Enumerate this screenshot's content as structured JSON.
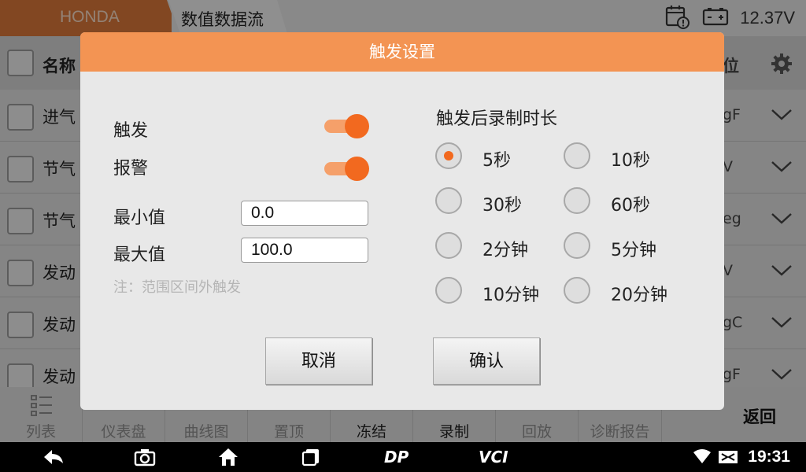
{
  "topbar": {
    "brand": "HONDA",
    "breadcrumb": "数值数据流",
    "voltage": "12.37V"
  },
  "table": {
    "header_name": "名称",
    "header_unit": "位",
    "rows": [
      {
        "name": "进气",
        "unit": "gF"
      },
      {
        "name": "节气",
        "unit": "V"
      },
      {
        "name": "节气",
        "unit": "eg"
      },
      {
        "name": "发动",
        "unit": "V"
      },
      {
        "name": "发动",
        "unit": "gC"
      },
      {
        "name": "发动",
        "unit": "gF"
      }
    ]
  },
  "toolbar": {
    "items": [
      "列表",
      "仪表盘",
      "曲线图",
      "置顶",
      "冻结",
      "录制",
      "回放",
      "诊断报告"
    ],
    "back": "返回"
  },
  "statusbar": {
    "time": "19:31",
    "dp_label": "DP",
    "vci_label": "VCI"
  },
  "dialog": {
    "title": "触发设置",
    "trigger_label": "触发",
    "trigger_on": true,
    "alarm_label": "报警",
    "alarm_on": true,
    "min_label": "最小值",
    "min_value": "0.0",
    "max_label": "最大值",
    "max_value": "100.0",
    "note": "注：范围区间外触发",
    "duration_title": "触发后录制时长",
    "options": [
      "5秒",
      "10秒",
      "30秒",
      "60秒",
      "2分钟",
      "5分钟",
      "10分钟",
      "20分钟"
    ],
    "selected_option": "5秒",
    "cancel": "取消",
    "confirm": "确认"
  },
  "colors": {
    "accent": "#f2691f",
    "title_bar": "#f39453",
    "brand_bar": "#d9773a"
  }
}
